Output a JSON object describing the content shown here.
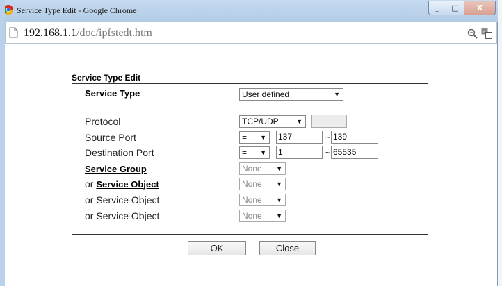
{
  "window": {
    "title": "Service Type Edit - Google Chrome",
    "url_host": "192.168.1.1",
    "url_path": "/doc/ipfstedt.htm",
    "controls": {
      "minimize": "_",
      "maximize": "□",
      "close": "X"
    }
  },
  "form": {
    "heading": "Service Type Edit",
    "service_type": {
      "label": "Service Type",
      "value": "User defined"
    },
    "protocol": {
      "label": "Protocol",
      "value": "TCP/UDP",
      "extra_value": ""
    },
    "source_port": {
      "label": "Source Port",
      "operator": "=",
      "start": "137",
      "tilde": "~",
      "end": "139"
    },
    "destination_port": {
      "label": "Destination Port",
      "operator": "=",
      "start": "1",
      "tilde": "~",
      "end": "65535"
    },
    "service_group": {
      "label": "Service Group",
      "value": "None"
    },
    "service_objects": [
      {
        "prefix": "or ",
        "label": "Service Object",
        "value": "None"
      },
      {
        "label": "or Service Object",
        "value": "None"
      },
      {
        "label": "or Service Object",
        "value": "None"
      }
    ]
  },
  "buttons": {
    "ok": "OK",
    "close": "Close"
  },
  "icons": {
    "app": "chrome-logo-icon",
    "page": "page-icon",
    "zoom": "zoom-icon",
    "translate": "translate-icon",
    "dropdown": "chevron-down-icon"
  },
  "colors": {
    "frame": "#b9d1ea",
    "close_button": "#d8a192"
  }
}
